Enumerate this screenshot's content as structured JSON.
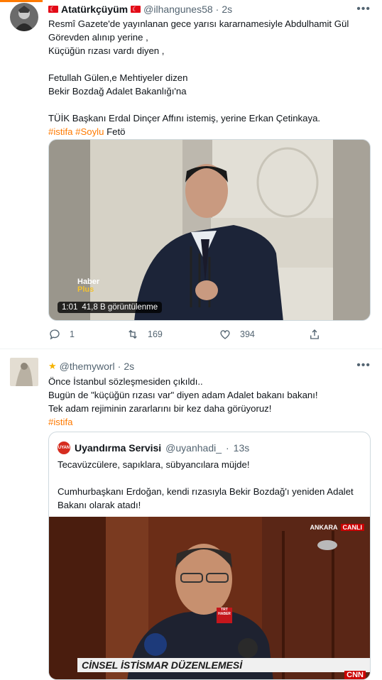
{
  "tweets": [
    {
      "name": "Atatürkçüyüm",
      "handle": "@ilhangunes58",
      "dot": "·",
      "time": "2s",
      "text": "Resmî Gazete'de yayınlanan gece yarısı kararnamesiyle Abdulhamit Gül\nGörevden alınıp yerine ,\nKüçüğün rızası vardı diyen ,\n\nFetullah Gülen,e Mehtiyeler dizen\nBekir Bozdağ Adalet Bakanlığı'na\n\nTÜİK Başkanı Erdal Dinçer Affını istemiş, yerine Erkan Çetinkaya.",
      "hashtags": [
        "#istifa",
        "#Soylu"
      ],
      "trailing_text": "Fetö",
      "media": {
        "duration": "1:01",
        "views": "41,8 B görüntülenme",
        "watermark_line1": "Haber",
        "watermark_line2": "Plus"
      },
      "actions": {
        "reply_count": "1",
        "retweet_count": "169",
        "like_count": "394"
      }
    },
    {
      "handle": "@themyworl",
      "dot": "·",
      "time": "2s",
      "text": "Önce İstanbul sözleşmesiden çıkıldı..\nBugün de \"küçüğün rızası var\" diyen adam Adalet bakanı bakanı!\nTek adam rejiminin zararlarını bir kez daha görüyoruz!",
      "hashtag": "#istifa",
      "quote": {
        "avatar_text": "UYAN",
        "name": "Uyandırma Servisi",
        "handle": "@uyanhadi_",
        "dot": "·",
        "time": "13s",
        "text": "Tecavüzcülere, sapıklara, sübyancılara müjde!\n\nCumhurbaşkanı Erdoğan, kendi rızasıyla Bekir Bozdağ'ı yeniden Adalet\nBakanı olarak atadı!",
        "media": {
          "location": "ANKARA",
          "live": "CANLI",
          "mic_label": "TRT HABER",
          "banner": "CİNSEL İSTİSMAR DÜZENLEMESİ",
          "channel": "CNN"
        }
      }
    }
  ],
  "colors": {
    "accent": "#ff7a00",
    "secondary_text": "#536471",
    "border": "#cfd9de"
  },
  "icons": {
    "more": "more-horizontal-icon",
    "reply": "reply-icon",
    "retweet": "retweet-icon",
    "like": "heart-icon",
    "share": "share-icon",
    "flag": "turkish-flag-icon",
    "star": "star-emoji-icon"
  }
}
